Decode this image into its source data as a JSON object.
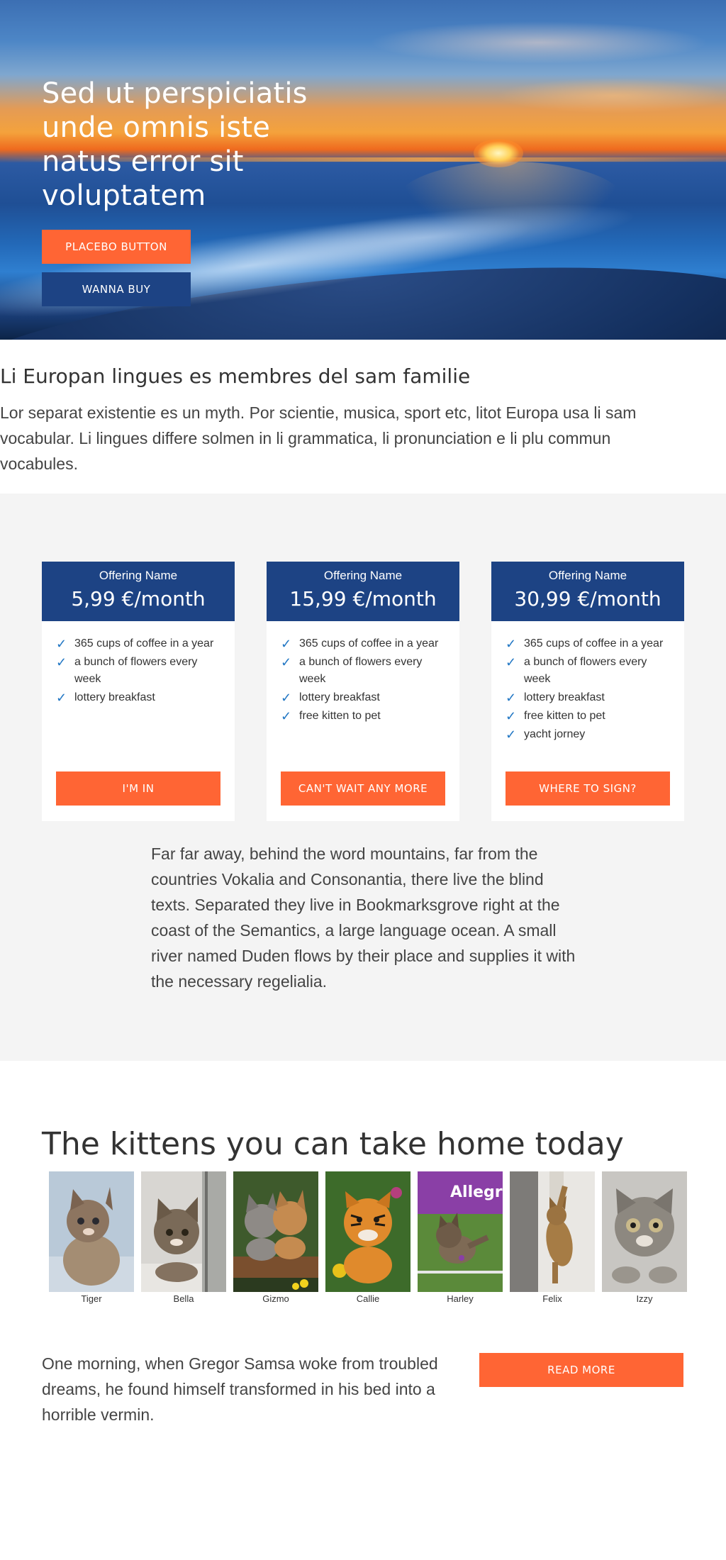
{
  "hero": {
    "title": "Sed ut perspiciatis unde omnis iste natus error sit voluptatem",
    "primary_button": "PLACEBO BUTTON",
    "secondary_button": "WANNA BUY"
  },
  "intro": {
    "title": "Li Europan lingues es membres del sam familie",
    "text": "Lor separat existentie es un myth. Por scientie, musica, sport etc, litot Europa usa li sam vocabular. Li lingues differe solmen in li grammatica, li pronunciation e li plu commun vocabules."
  },
  "pricing": {
    "cards": [
      {
        "name": "Offering Name",
        "price": "5,99 €/month",
        "features": [
          "365 cups of coffee in a year",
          "a bunch of flowers every week",
          "lottery breakfast"
        ],
        "button": "I'M IN"
      },
      {
        "name": "Offering Name",
        "price": "15,99 €/month",
        "features": [
          "365 cups of coffee in a year",
          "a bunch of flowers every week",
          "lottery breakfast",
          "free kitten to pet"
        ],
        "button": "CAN'T WAIT ANY MORE"
      },
      {
        "name": "Offering Name",
        "price": "30,99 €/month",
        "features": [
          "365 cups of coffee in a year",
          "a bunch of flowers every week",
          "lottery breakfast",
          "free kitten to pet",
          "yacht jorney"
        ],
        "button": "WHERE TO SIGN?"
      }
    ],
    "text": "Far far away, behind the word mountains, far from the countries Vokalia and Consonantia, there live the blind texts. Separated they live in Bookmarksgrove right at the coast of the Semantics, a large language ocean. A small river named Duden flows by their place and supplies it with the necessary regelialia."
  },
  "kittens": {
    "title": "The kittens you can take home today",
    "items": [
      {
        "name": "Tiger"
      },
      {
        "name": "Bella"
      },
      {
        "name": "Gizmo"
      },
      {
        "name": "Callie"
      },
      {
        "name": "Harley",
        "sign_text": "Allegr"
      },
      {
        "name": "Felix"
      },
      {
        "name": "Izzy"
      }
    ]
  },
  "footer": {
    "text": "One morning, when Gregor Samsa woke from troubled dreams, he found himself transformed in his bed into a horrible vermin.",
    "button": "READ MORE"
  },
  "icons": {
    "feature_check": "check-icon"
  },
  "colors": {
    "accent_orange": "#ff6534",
    "brand_blue": "#1d4384",
    "section_gray": "#f4f4f4",
    "check_blue": "#2277c4"
  }
}
